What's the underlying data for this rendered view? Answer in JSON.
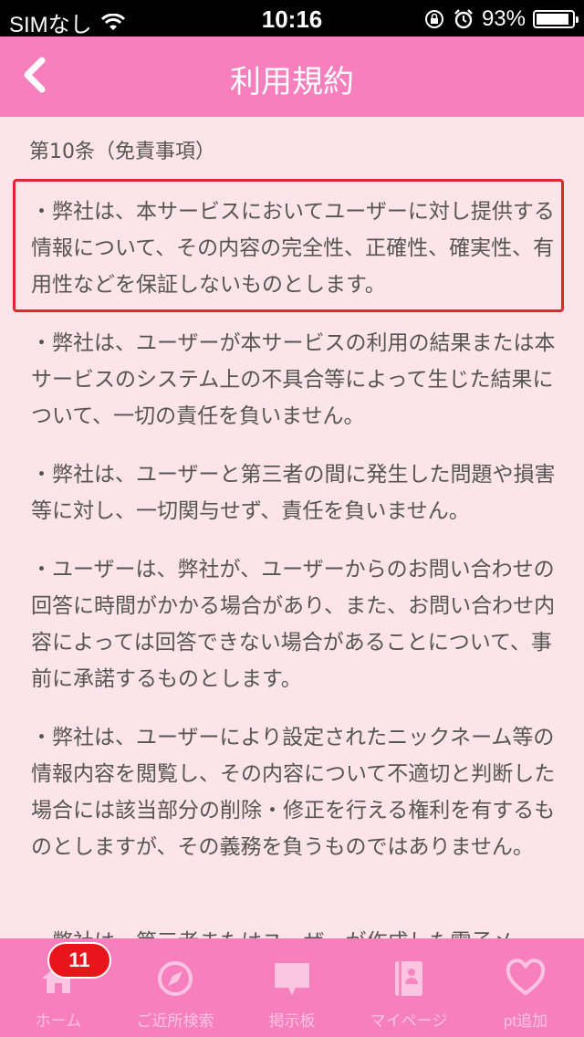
{
  "status_bar": {
    "carrier": "SIMなし",
    "time": "10:16",
    "battery_percent": "93%",
    "battery_level": 0.93
  },
  "nav": {
    "title": "利用規約"
  },
  "content": {
    "section_title": "第10条（免責事項）",
    "paragraphs": [
      "・弊社は、本サービスにおいてユーザーに対し提供する情報について、その内容の完全性、正確性、確実性、有用性などを保証しないものとします。",
      "・弊社は、ユーザーが本サービスの利用の結果または本サービスのシステム上の不具合等によって生じた結果について、一切の責任を負いません。",
      "・弊社は、ユーザーと第三者の間に発生した問題や損害等に対し、一切関与せず、責任を負いません。",
      "・ユーザーは、弊社が、ユーザーからのお問い合わせの回答に時間がかかる場合があり、また、お問い合わせ内容によっては回答できない場合があることについて、事前に承諾するものとします。",
      "・弊社は、ユーザーにより設定されたニックネーム等の情報内容を閲覧し、その内容について不適切と判断した場合には該当部分の削除・修正を行える権利を有するものとしますが、その義務を負うものではありません。",
      "・弊社は、第三者またはユーザーが作成した電子メー"
    ]
  },
  "tabs": [
    {
      "label": "ホーム",
      "icon": "home-icon"
    },
    {
      "label": "ご近所検索",
      "icon": "compass-icon"
    },
    {
      "label": "掲示板",
      "icon": "chat-bubble-icon"
    },
    {
      "label": "マイページ",
      "icon": "profile-book-icon"
    },
    {
      "label": "pt追加",
      "icon": "heart-icon"
    }
  ],
  "badge": {
    "count": "11"
  },
  "colors": {
    "accent_pink": "#f77fbe",
    "background": "#fde3ea",
    "highlight_border": "#e0282e",
    "badge_red": "#e8151b"
  }
}
